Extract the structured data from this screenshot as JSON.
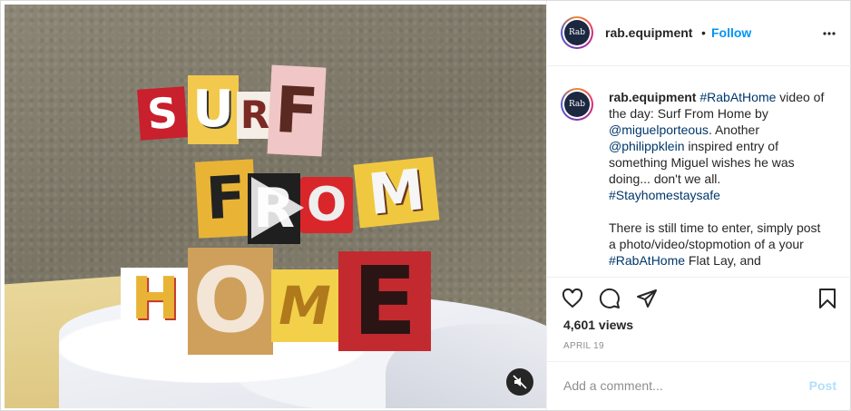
{
  "media": {
    "letters": {
      "surf": [
        "S",
        "U",
        "R",
        "F"
      ],
      "from": [
        "F",
        "R",
        "O",
        "M"
      ],
      "home": [
        "H",
        "O",
        "M",
        "E"
      ]
    }
  },
  "header": {
    "username": "rab.equipment",
    "separator": "•",
    "follow_label": "Follow",
    "more_icon": "more-horizontal-icon",
    "avatar_text": "Rab"
  },
  "caption": {
    "username": "rab.equipment",
    "segments": [
      {
        "text": "#RabAtHome",
        "type": "tag"
      },
      {
        "text": " video of the day: Surf From Home by ",
        "type": "text"
      },
      {
        "text": "@miguelporteous",
        "type": "tag"
      },
      {
        "text": ". Another ",
        "type": "text"
      },
      {
        "text": "@philippklein",
        "type": "tag"
      },
      {
        "text": " inspired entry of something Miguel wishes he was doing... don't we all. ",
        "type": "text"
      },
      {
        "text": "#Stayhomestaysafe",
        "type": "tag"
      }
    ],
    "paragraph2_start": "There is still time to enter, simply post a photo/video/stopmotion of a your ",
    "paragraph2_tag": "#RabAtHome",
    "paragraph2_end": " Flat Lay, and"
  },
  "actions": {
    "icons": [
      "heart-icon",
      "comment-icon",
      "share-icon",
      "bookmark-icon"
    ],
    "views": "4,601 views",
    "date": "APRIL 19"
  },
  "comment": {
    "placeholder": "Add a comment...",
    "post_label": "Post"
  },
  "colors": {
    "link": "#00376b",
    "follow": "#0095f6",
    "post_disabled": "#b2dffc"
  }
}
